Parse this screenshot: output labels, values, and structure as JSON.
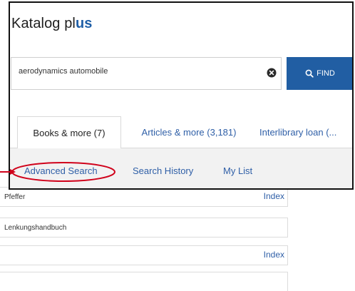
{
  "background": {
    "rows": [
      {
        "left_text": "Pfeffer",
        "right_link": "Index"
      },
      {
        "left_text": "Lenkungshandbuch",
        "right_link": ""
      },
      {
        "left_text": "",
        "right_link": "Index"
      },
      {
        "left_text": "",
        "right_link": ""
      }
    ]
  },
  "header": {
    "brand_prefix": "Katalog pl",
    "brand_accent": "us"
  },
  "search": {
    "value": "aerodynamics automobile",
    "clear_icon": "circle-x-icon",
    "find_label": "FIND",
    "find_icon": "search-icon"
  },
  "tabs": [
    {
      "label": "Books & more (7)",
      "active": true
    },
    {
      "label": "Articles & more (3,181)",
      "active": false
    },
    {
      "label": "Interlibrary loan (...",
      "active": false
    }
  ],
  "subnav": {
    "advanced_search": "Advanced Search",
    "search_history": "Search History",
    "my_list": "My List"
  },
  "colors": {
    "accent": "#215ea3",
    "link": "#2f5fa7",
    "highlight": "#d0021b",
    "subnav_bg": "#f2f2f2"
  }
}
